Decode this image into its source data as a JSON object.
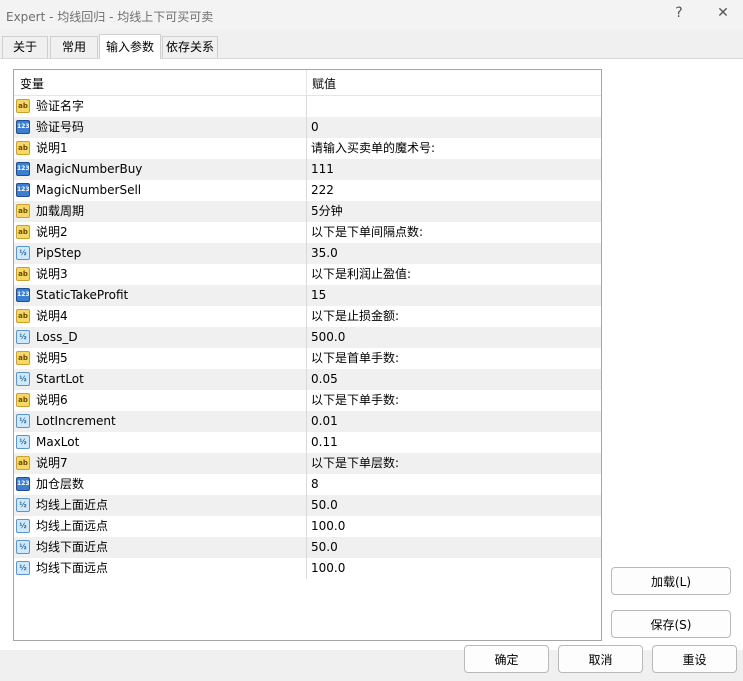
{
  "window": {
    "title": "Expert - 均线回归 - 均线上下可买可卖",
    "help_glyph": "?",
    "close_glyph": "✕"
  },
  "tabs": [
    {
      "label": "关于"
    },
    {
      "label": "常用"
    },
    {
      "label": "输入参数",
      "active": true
    },
    {
      "label": "依存关系"
    }
  ],
  "grid": {
    "header_variable": "变量",
    "header_value": "赋值",
    "rows": [
      {
        "type": "ab",
        "name": "验证名字",
        "value": ""
      },
      {
        "type": "int",
        "name": "验证号码",
        "value": "0"
      },
      {
        "type": "ab",
        "name": "说明1",
        "value": "请输入买卖单的魔术号:"
      },
      {
        "type": "int",
        "name": "MagicNumberBuy",
        "value": "111"
      },
      {
        "type": "int",
        "name": "MagicNumberSell",
        "value": "222"
      },
      {
        "type": "ab",
        "name": "加载周期",
        "value": " 5分钟"
      },
      {
        "type": "ab",
        "name": "说明2",
        "value": "以下是下单间隔点数:"
      },
      {
        "type": "dbl",
        "name": "PipStep",
        "value": "35.0"
      },
      {
        "type": "ab",
        "name": "说明3",
        "value": "以下是利润止盈值:"
      },
      {
        "type": "int",
        "name": "StaticTakeProfit",
        "value": "15"
      },
      {
        "type": "ab",
        "name": "说明4",
        "value": "以下是止损金额:"
      },
      {
        "type": "dbl",
        "name": "Loss_D",
        "value": "500.0"
      },
      {
        "type": "ab",
        "name": "说明5",
        "value": "以下是首单手数:"
      },
      {
        "type": "dbl",
        "name": "StartLot",
        "value": "0.05"
      },
      {
        "type": "ab",
        "name": "说明6",
        "value": "以下是下单手数:"
      },
      {
        "type": "dbl",
        "name": "LotIncrement",
        "value": "0.01"
      },
      {
        "type": "dbl",
        "name": "MaxLot",
        "value": "0.11"
      },
      {
        "type": "ab",
        "name": "说明7",
        "value": "以下是下单层数:"
      },
      {
        "type": "int",
        "name": "加仓层数",
        "value": "8"
      },
      {
        "type": "dbl",
        "name": "均线上面近点",
        "value": "50.0"
      },
      {
        "type": "dbl",
        "name": "均线上面远点",
        "value": "100.0"
      },
      {
        "type": "dbl",
        "name": "均线下面近点",
        "value": "50.0"
      },
      {
        "type": "dbl",
        "name": "均线下面远点",
        "value": "100.0"
      }
    ]
  },
  "icons": {
    "ab": "ab",
    "int": "123",
    "dbl": "½"
  },
  "buttons": {
    "load": "加载(L)",
    "save": "保存(S)",
    "ok": "确定",
    "cancel": "取消",
    "reset": "重设"
  }
}
